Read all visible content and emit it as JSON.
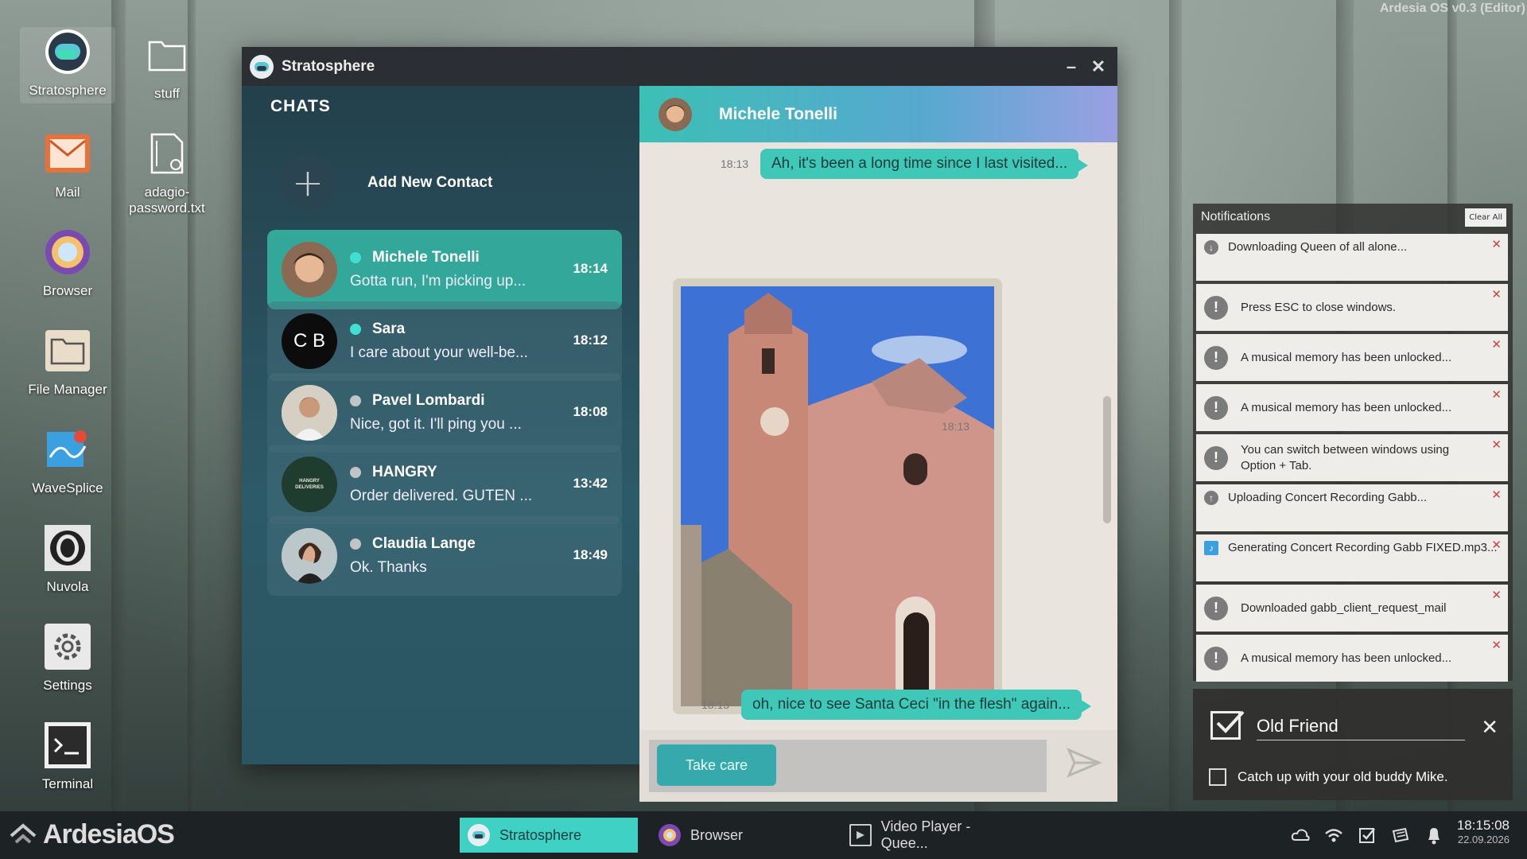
{
  "os": {
    "version_label": "Ardesia OS v0.3 (Editor)",
    "brand": "ArdesiaOS"
  },
  "desktop": {
    "icons": [
      {
        "label": "Stratosphere",
        "icon": "stratosphere-app-icon"
      },
      {
        "label": "stuff",
        "icon": "folder-icon"
      },
      {
        "label": "Mail",
        "icon": "mail-icon"
      },
      {
        "label": "adagio-password.txt",
        "icon": "text-file-icon"
      },
      {
        "label": "Browser",
        "icon": "browser-icon"
      },
      {
        "label": "File Manager",
        "icon": "file-manager-icon"
      },
      {
        "label": "WaveSplice",
        "icon": "wavesplice-icon"
      },
      {
        "label": "Nuvola",
        "icon": "nuvola-icon"
      },
      {
        "label": "Settings",
        "icon": "gear-icon"
      },
      {
        "label": "Terminal",
        "icon": "terminal-icon"
      }
    ]
  },
  "window": {
    "title": "Stratosphere",
    "chats": {
      "heading": "CHATS",
      "add_contact": "Add New Contact",
      "contacts": [
        {
          "name": "Michele Tonelli",
          "preview": "Gotta run, I'm picking up...",
          "time": "18:14",
          "online": true,
          "active": true
        },
        {
          "name": "Sara",
          "preview": "I care about your well-be...",
          "time": "18:12",
          "online": true,
          "initials": "C B"
        },
        {
          "name": "Pavel Lombardi",
          "preview": "Nice, got it. I'll ping you ...",
          "time": "18:08",
          "online": false
        },
        {
          "name": "HANGRY",
          "preview": "Order delivered. GUTEN ...",
          "time": "13:42",
          "online": false,
          "logo_text": "HANGRY DELIVERIES"
        },
        {
          "name": "Claudia Lange",
          "preview": "Ok. Thanks",
          "time": "18:49",
          "online": false
        }
      ]
    },
    "conversation": {
      "contact_name": "Michele Tonelli",
      "messages": [
        {
          "time": "18:13",
          "text": "Ah, it's been a long time since I last visited..."
        },
        {
          "time": "18:13",
          "type": "photo"
        },
        {
          "time": "18:13",
          "text": "oh, nice to see Santa Ceci \"in the flesh\" again..."
        }
      ],
      "reply_option": "Take care"
    }
  },
  "notifications": {
    "title": "Notifications",
    "clear_all": "Clear All",
    "items": [
      {
        "text": "Downloading Queen of all alone...",
        "icon": "download-icon"
      },
      {
        "text": "Press ESC to close windows.",
        "icon": "exclamation-icon"
      },
      {
        "text": "A musical memory has been unlocked...",
        "icon": "exclamation-icon"
      },
      {
        "text": "A musical memory has been unlocked...",
        "icon": "exclamation-icon"
      },
      {
        "text": "You can switch between windows using Option + Tab.",
        "icon": "exclamation-icon"
      },
      {
        "text": "Uploading Concert Recording Gabb...",
        "icon": "upload-icon"
      },
      {
        "text": "Generating Concert Recording Gabb FIXED.mp3...",
        "icon": "wavesplice-icon"
      },
      {
        "text": "Downloaded gabb_client_request_mail",
        "icon": "exclamation-icon"
      },
      {
        "text": "A musical memory has been unlocked...",
        "icon": "exclamation-icon"
      }
    ]
  },
  "task": {
    "title": "Old Friend",
    "description": "Catch up with your old buddy Mike."
  },
  "taskbar": {
    "apps": [
      {
        "label": "Stratosphere",
        "active": true
      },
      {
        "label": "Browser",
        "active": false
      },
      {
        "label": "Video Player - Quee...",
        "active": false
      }
    ],
    "time": "18:15:08",
    "date": "22.09.2026"
  },
  "colors": {
    "accent": "#3ed1c4",
    "online": "#3fe0d0",
    "offline": "#bfc4c6"
  }
}
